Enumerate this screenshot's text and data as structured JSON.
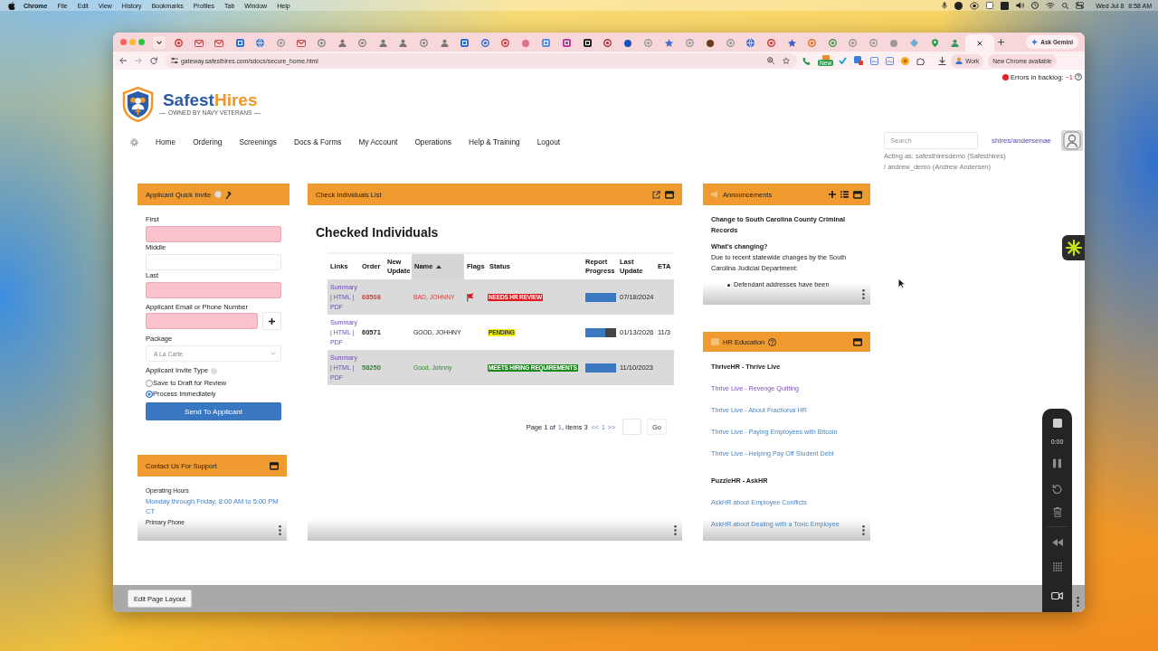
{
  "menubar": {
    "app": "Chrome",
    "menus": [
      "File",
      "Edit",
      "View",
      "History",
      "Bookmarks",
      "Profiles",
      "Tab",
      "Window",
      "Help"
    ],
    "date": "Wed Jul 8",
    "time": "8:58 AM"
  },
  "browser": {
    "tabs": [
      {
        "selected": false
      },
      {
        "selected": false
      },
      {
        "selected": false
      },
      {
        "selected": false
      },
      {
        "selected": false
      },
      {
        "selected": false
      },
      {
        "selected": false
      },
      {
        "selected": false
      },
      {
        "selected": false
      },
      {
        "selected": false
      },
      {
        "selected": false
      },
      {
        "selected": false
      },
      {
        "selected": false
      },
      {
        "selected": false
      },
      {
        "selected": false
      },
      {
        "selected": false
      },
      {
        "selected": false
      },
      {
        "selected": false
      },
      {
        "selected": false
      },
      {
        "selected": false
      },
      {
        "selected": false
      },
      {
        "selected": false
      },
      {
        "selected": false
      },
      {
        "selected": false
      },
      {
        "selected": false
      },
      {
        "selected": false
      },
      {
        "selected": false
      },
      {
        "selected": false
      },
      {
        "selected": false
      },
      {
        "selected": false
      },
      {
        "selected": false
      },
      {
        "selected": false
      },
      {
        "selected": false
      },
      {
        "selected": false
      },
      {
        "selected": false
      },
      {
        "selected": false
      },
      {
        "selected": false
      },
      {
        "selected": false
      },
      {
        "selected": false
      },
      {
        "selected": true
      }
    ],
    "ask_gemini": "Ask Gemini",
    "url": "gateway.safesthires.com/sdocs/secure_home.html",
    "extension_badge": "New",
    "profile": "Work",
    "update": "New Chrome available"
  },
  "header": {
    "errors": {
      "label": "Errors in backlog:",
      "count": "~1"
    },
    "logo": {
      "brand": [
        "Safest",
        "Hires"
      ],
      "tagline": "OWNED BY NAVY VETERANS"
    },
    "nav": [
      "Home",
      "Ordering",
      "Screenings",
      "Docs & Forms",
      "My Account",
      "Operations",
      "Help & Training",
      "Logout"
    ],
    "search": {
      "placeholder": "Search"
    },
    "user": "shires/andersenae",
    "acting_as": [
      "Acting as: safesthiresdemo (Safesthires)",
      "/ andrew_demo (Andrew Andersen)"
    ]
  },
  "quick_invite": {
    "title": "Applicant Quick Invite",
    "fields": [
      {
        "label": "First",
        "required": true
      },
      {
        "label": "Middle",
        "required": false
      },
      {
        "label": "Last",
        "required": true
      }
    ],
    "contact": {
      "label": "Applicant Email or Phone Number",
      "required": true
    },
    "package": {
      "label": "Package",
      "value": "A La Carte"
    },
    "invite_type": {
      "label": "Applicant Invite Type",
      "options": [
        {
          "label": "Save to Draft for Review",
          "selected": false
        },
        {
          "label": "Process Immediately",
          "selected": true
        }
      ]
    },
    "submit": "Send To Applicant"
  },
  "support": {
    "title": "Contact Us For Support",
    "hours_label": "Operating Hours",
    "hours": "Monday through Friday, 8:00 AM to 5:00 PM CT",
    "phone_label": "Primary Phone"
  },
  "check_list": {
    "title": "Check Individuals List",
    "heading": "Checked Individuals",
    "table": {
      "columns": [
        {
          "label": "Links",
          "sorted": false
        },
        {
          "label": "Order",
          "sorted": false
        },
        {
          "label": "New Update",
          "sorted": false
        },
        {
          "label": "Name",
          "sorted": true
        },
        {
          "label": "Flags",
          "sorted": false
        },
        {
          "label": "Status",
          "sorted": false
        },
        {
          "label": "Report Progress",
          "sorted": false
        },
        {
          "label": "Last Update",
          "sorted": false
        },
        {
          "label": "ETA",
          "sorted": false
        }
      ],
      "link_separator": "|",
      "rows": [
        {
          "links": [
            "Summary",
            "HTML",
            "PDF"
          ],
          "order": "68508",
          "name": "BAD, JOHNNY",
          "color": "#e53935",
          "flagged": true,
          "status": {
            "label": "NEEDS HR REVIEW",
            "color": "#e3131b"
          },
          "level": 1,
          "last_update": "07/18/2024"
        },
        {
          "links": [
            "Summary",
            "HTML",
            "PDF"
          ],
          "order": "60571",
          "name": "GOOD, JOHHNY",
          "color": "#222222",
          "flagged": false,
          "status": {
            "label": "PENDING",
            "color": "#f2f20a"
          },
          "level": 0.65,
          "last_update": "01/13/2026",
          "eta": "11/3"
        },
        {
          "links": [
            "Summary",
            "HTML",
            "PDF"
          ],
          "order": "58250",
          "name": "Good, Johnny",
          "color": "#2e8b2e",
          "flagged": false,
          "status": {
            "label": "MEETS HIRING REQUIREMENTS",
            "color": "#1b8a1b"
          },
          "level": 1,
          "last_update": "11/10/2023"
        }
      ]
    },
    "pager": {
      "page_text": "Page 1 of",
      "page_count": "1",
      "items_text": ", Items 3",
      "prev": "<<",
      "current": "1",
      "next": ">>",
      "go": "Go"
    }
  },
  "announcements": {
    "title": "Announcements",
    "heading": "Change to South Carolina County Criminal Records",
    "subheading": "What’s changing?",
    "body": "Due to recent statewide changes by the South Carolina Judicial Department:",
    "bullets": [
      "Defendant addresses have been"
    ]
  },
  "hr_education": {
    "title": "HR Education",
    "groups": [
      {
        "heading": "ThriveHR - Thrive Live",
        "links": [
          {
            "label": "Thrive Live - Revenge Quitting",
            "visited": true
          },
          {
            "label": "Thrive Live - About Fractional HR",
            "visited": false
          },
          {
            "label": "Thrive Live - Paying Employees with Bitcoin",
            "visited": false
          },
          {
            "label": "Thrive Live - Helping Pay Off Student Debt",
            "visited": false
          }
        ]
      },
      {
        "heading": "PuzzleHR - AskHR",
        "links": [
          {
            "label": "AskHR about Employee Conflicts",
            "visited": false
          },
          {
            "label": "AskHR about Dealing with a Toxic Employee",
            "visited": false
          }
        ]
      }
    ]
  },
  "footer": {
    "button": "Edit Page Layout"
  },
  "recorder": {
    "time": "0:00"
  }
}
